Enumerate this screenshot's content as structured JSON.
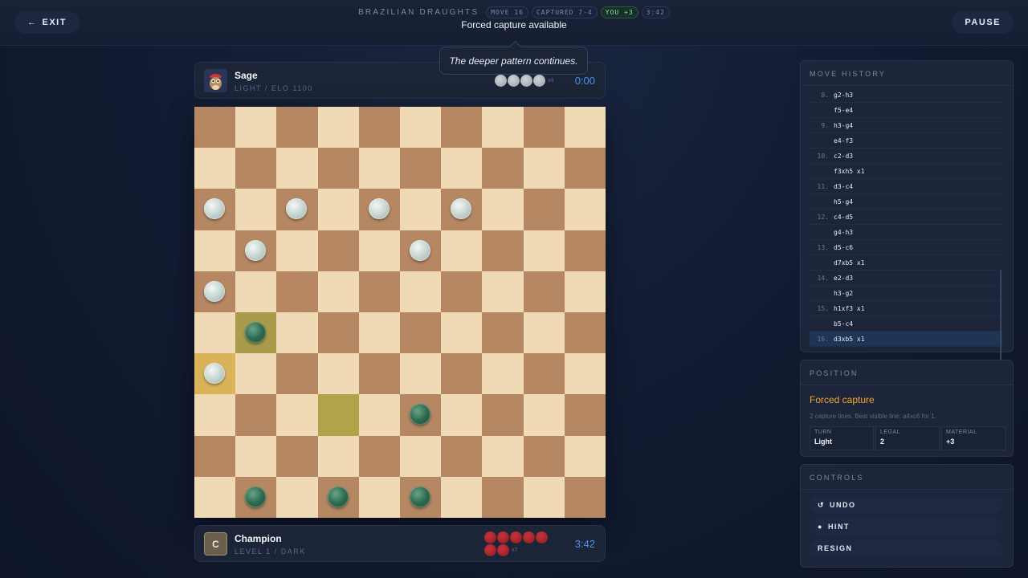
{
  "header": {
    "exit_label": "EXIT",
    "pause_label": "PAUSE",
    "game_title": "BRAZILIAN DRAUGHTS",
    "move_pill": "MOVE 16",
    "captured_pill": "CAPTURED 7-4",
    "you_pill": "YOU +3",
    "clock_pill": "3:42",
    "subtitle": "Forced capture available"
  },
  "tooltip": "The deeper pattern continues.",
  "opponent": {
    "name": "Sage",
    "meta": "LIGHT / ELO 1100",
    "time": "0:00",
    "captured_count": 4,
    "captured_label": "x4"
  },
  "player": {
    "avatar_letter": "C",
    "name": "Champion",
    "meta": "LEVEL 1 / DARK",
    "time": "3:42",
    "captured_count": 7,
    "captured_label": "x7"
  },
  "board": {
    "size": 10,
    "light_pieces": [
      "a8",
      "c8",
      "e8",
      "g8",
      "b7",
      "f7",
      "a6",
      "a4"
    ],
    "dark_pieces": [
      "b5",
      "f3",
      "b1",
      "d1",
      "f1"
    ],
    "highlight_from": "a4",
    "highlight_origin": "b5",
    "highlight_last": "d3",
    "target_ring": "c6"
  },
  "history": {
    "title": "MOVE HISTORY",
    "rows": [
      {
        "num": "8.",
        "move": "g2-h3"
      },
      {
        "num": "",
        "move": "f5-e4"
      },
      {
        "num": "9.",
        "move": "h3-g4"
      },
      {
        "num": "",
        "move": "e4-f3"
      },
      {
        "num": "10.",
        "move": "c2-d3"
      },
      {
        "num": "",
        "move": "f3xh5 x1"
      },
      {
        "num": "11.",
        "move": "d3-c4"
      },
      {
        "num": "",
        "move": "h5-g4"
      },
      {
        "num": "12.",
        "move": "c4-d5"
      },
      {
        "num": "",
        "move": "g4-h3"
      },
      {
        "num": "13.",
        "move": "d5-c6"
      },
      {
        "num": "",
        "move": "d7xb5 x1"
      },
      {
        "num": "14.",
        "move": "e2-d3"
      },
      {
        "num": "",
        "move": "h3-g2"
      },
      {
        "num": "15.",
        "move": "h1xf3 x1"
      },
      {
        "num": "",
        "move": "b5-c4"
      },
      {
        "num": "16.",
        "move": "d3xb5 x1"
      }
    ],
    "active_index": 16
  },
  "position": {
    "title": "POSITION",
    "status": "Forced capture",
    "description": "2 capture lines. Best visible line: a4xc6 for 1.",
    "turn_label": "TURN",
    "turn_value": "Light",
    "legal_label": "LEGAL",
    "legal_value": "2",
    "material_label": "MATERIAL",
    "material_value": "+3"
  },
  "controls": {
    "title": "CONTROLS",
    "undo_label": "UNDO",
    "hint_label": "HINT",
    "resign_label": "RESIGN"
  },
  "colors": {
    "accent": "#4a92ea",
    "warning": "#f0a832",
    "board_dark": "#b58863",
    "board_light": "#f0d9b5"
  }
}
